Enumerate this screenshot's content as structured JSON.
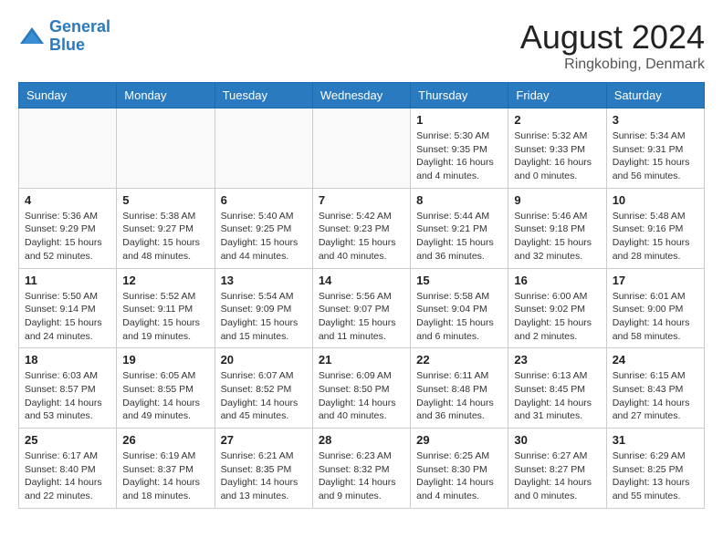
{
  "header": {
    "logo_line1": "General",
    "logo_line2": "Blue",
    "month_year": "August 2024",
    "location": "Ringkobing, Denmark"
  },
  "days_of_week": [
    "Sunday",
    "Monday",
    "Tuesday",
    "Wednesday",
    "Thursday",
    "Friday",
    "Saturday"
  ],
  "weeks": [
    [
      {
        "num": "",
        "info": ""
      },
      {
        "num": "",
        "info": ""
      },
      {
        "num": "",
        "info": ""
      },
      {
        "num": "",
        "info": ""
      },
      {
        "num": "1",
        "info": "Sunrise: 5:30 AM\nSunset: 9:35 PM\nDaylight: 16 hours\nand 4 minutes."
      },
      {
        "num": "2",
        "info": "Sunrise: 5:32 AM\nSunset: 9:33 PM\nDaylight: 16 hours\nand 0 minutes."
      },
      {
        "num": "3",
        "info": "Sunrise: 5:34 AM\nSunset: 9:31 PM\nDaylight: 15 hours\nand 56 minutes."
      }
    ],
    [
      {
        "num": "4",
        "info": "Sunrise: 5:36 AM\nSunset: 9:29 PM\nDaylight: 15 hours\nand 52 minutes."
      },
      {
        "num": "5",
        "info": "Sunrise: 5:38 AM\nSunset: 9:27 PM\nDaylight: 15 hours\nand 48 minutes."
      },
      {
        "num": "6",
        "info": "Sunrise: 5:40 AM\nSunset: 9:25 PM\nDaylight: 15 hours\nand 44 minutes."
      },
      {
        "num": "7",
        "info": "Sunrise: 5:42 AM\nSunset: 9:23 PM\nDaylight: 15 hours\nand 40 minutes."
      },
      {
        "num": "8",
        "info": "Sunrise: 5:44 AM\nSunset: 9:21 PM\nDaylight: 15 hours\nand 36 minutes."
      },
      {
        "num": "9",
        "info": "Sunrise: 5:46 AM\nSunset: 9:18 PM\nDaylight: 15 hours\nand 32 minutes."
      },
      {
        "num": "10",
        "info": "Sunrise: 5:48 AM\nSunset: 9:16 PM\nDaylight: 15 hours\nand 28 minutes."
      }
    ],
    [
      {
        "num": "11",
        "info": "Sunrise: 5:50 AM\nSunset: 9:14 PM\nDaylight: 15 hours\nand 24 minutes."
      },
      {
        "num": "12",
        "info": "Sunrise: 5:52 AM\nSunset: 9:11 PM\nDaylight: 15 hours\nand 19 minutes."
      },
      {
        "num": "13",
        "info": "Sunrise: 5:54 AM\nSunset: 9:09 PM\nDaylight: 15 hours\nand 15 minutes."
      },
      {
        "num": "14",
        "info": "Sunrise: 5:56 AM\nSunset: 9:07 PM\nDaylight: 15 hours\nand 11 minutes."
      },
      {
        "num": "15",
        "info": "Sunrise: 5:58 AM\nSunset: 9:04 PM\nDaylight: 15 hours\nand 6 minutes."
      },
      {
        "num": "16",
        "info": "Sunrise: 6:00 AM\nSunset: 9:02 PM\nDaylight: 15 hours\nand 2 minutes."
      },
      {
        "num": "17",
        "info": "Sunrise: 6:01 AM\nSunset: 9:00 PM\nDaylight: 14 hours\nand 58 minutes."
      }
    ],
    [
      {
        "num": "18",
        "info": "Sunrise: 6:03 AM\nSunset: 8:57 PM\nDaylight: 14 hours\nand 53 minutes."
      },
      {
        "num": "19",
        "info": "Sunrise: 6:05 AM\nSunset: 8:55 PM\nDaylight: 14 hours\nand 49 minutes."
      },
      {
        "num": "20",
        "info": "Sunrise: 6:07 AM\nSunset: 8:52 PM\nDaylight: 14 hours\nand 45 minutes."
      },
      {
        "num": "21",
        "info": "Sunrise: 6:09 AM\nSunset: 8:50 PM\nDaylight: 14 hours\nand 40 minutes."
      },
      {
        "num": "22",
        "info": "Sunrise: 6:11 AM\nSunset: 8:48 PM\nDaylight: 14 hours\nand 36 minutes."
      },
      {
        "num": "23",
        "info": "Sunrise: 6:13 AM\nSunset: 8:45 PM\nDaylight: 14 hours\nand 31 minutes."
      },
      {
        "num": "24",
        "info": "Sunrise: 6:15 AM\nSunset: 8:43 PM\nDaylight: 14 hours\nand 27 minutes."
      }
    ],
    [
      {
        "num": "25",
        "info": "Sunrise: 6:17 AM\nSunset: 8:40 PM\nDaylight: 14 hours\nand 22 minutes."
      },
      {
        "num": "26",
        "info": "Sunrise: 6:19 AM\nSunset: 8:37 PM\nDaylight: 14 hours\nand 18 minutes."
      },
      {
        "num": "27",
        "info": "Sunrise: 6:21 AM\nSunset: 8:35 PM\nDaylight: 14 hours\nand 13 minutes."
      },
      {
        "num": "28",
        "info": "Sunrise: 6:23 AM\nSunset: 8:32 PM\nDaylight: 14 hours\nand 9 minutes."
      },
      {
        "num": "29",
        "info": "Sunrise: 6:25 AM\nSunset: 8:30 PM\nDaylight: 14 hours\nand 4 minutes."
      },
      {
        "num": "30",
        "info": "Sunrise: 6:27 AM\nSunset: 8:27 PM\nDaylight: 14 hours\nand 0 minutes."
      },
      {
        "num": "31",
        "info": "Sunrise: 6:29 AM\nSunset: 8:25 PM\nDaylight: 13 hours\nand 55 minutes."
      }
    ]
  ]
}
